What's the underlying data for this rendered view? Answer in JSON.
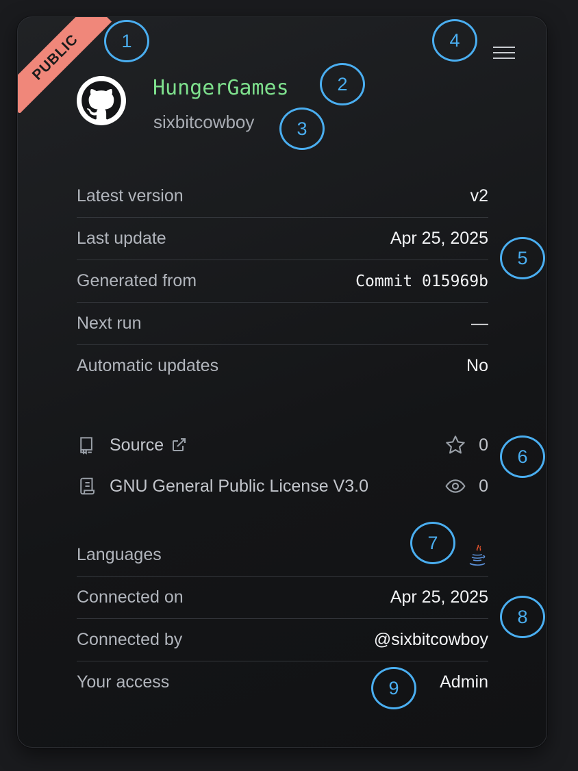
{
  "visibility": "PUBLIC",
  "repo": {
    "name": "HungerGames",
    "owner": "sixbitcowboy",
    "avatar_icon": "github-octocat-icon"
  },
  "menu_icon": "hamburger-menu-icon",
  "details": [
    {
      "label": "Latest version",
      "value": "v2"
    },
    {
      "label": "Last update",
      "value": "Apr 25, 2025"
    },
    {
      "label": "Generated from",
      "value": "Commit 015969b"
    },
    {
      "label": "Next run",
      "value": "—"
    },
    {
      "label": "Automatic updates",
      "value": "No"
    }
  ],
  "links": {
    "source": {
      "label": "Source",
      "icon": "repo-book-icon",
      "ext_icon": "external-link-icon"
    },
    "license": {
      "label": "GNU General Public License V3.0",
      "icon": "license-scroll-icon"
    },
    "stars": {
      "count": "0",
      "icon": "star-icon"
    },
    "watchers": {
      "count": "0",
      "icon": "eye-icon"
    }
  },
  "languages": {
    "label": "Languages",
    "icon": "java-icon"
  },
  "connection": [
    {
      "label": "Connected on",
      "value": "Apr 25, 2025"
    },
    {
      "label": "Connected by",
      "value": "@sixbitcowboy"
    },
    {
      "label": "Your access",
      "value": "Admin"
    }
  ],
  "callouts": [
    "1",
    "2",
    "3",
    "4",
    "5",
    "6",
    "7",
    "8",
    "9"
  ],
  "colors": {
    "ribbon": "#f0877a",
    "repo_name": "#7ee08d",
    "callout": "#4aaef0",
    "background": "#1a1b1e"
  }
}
